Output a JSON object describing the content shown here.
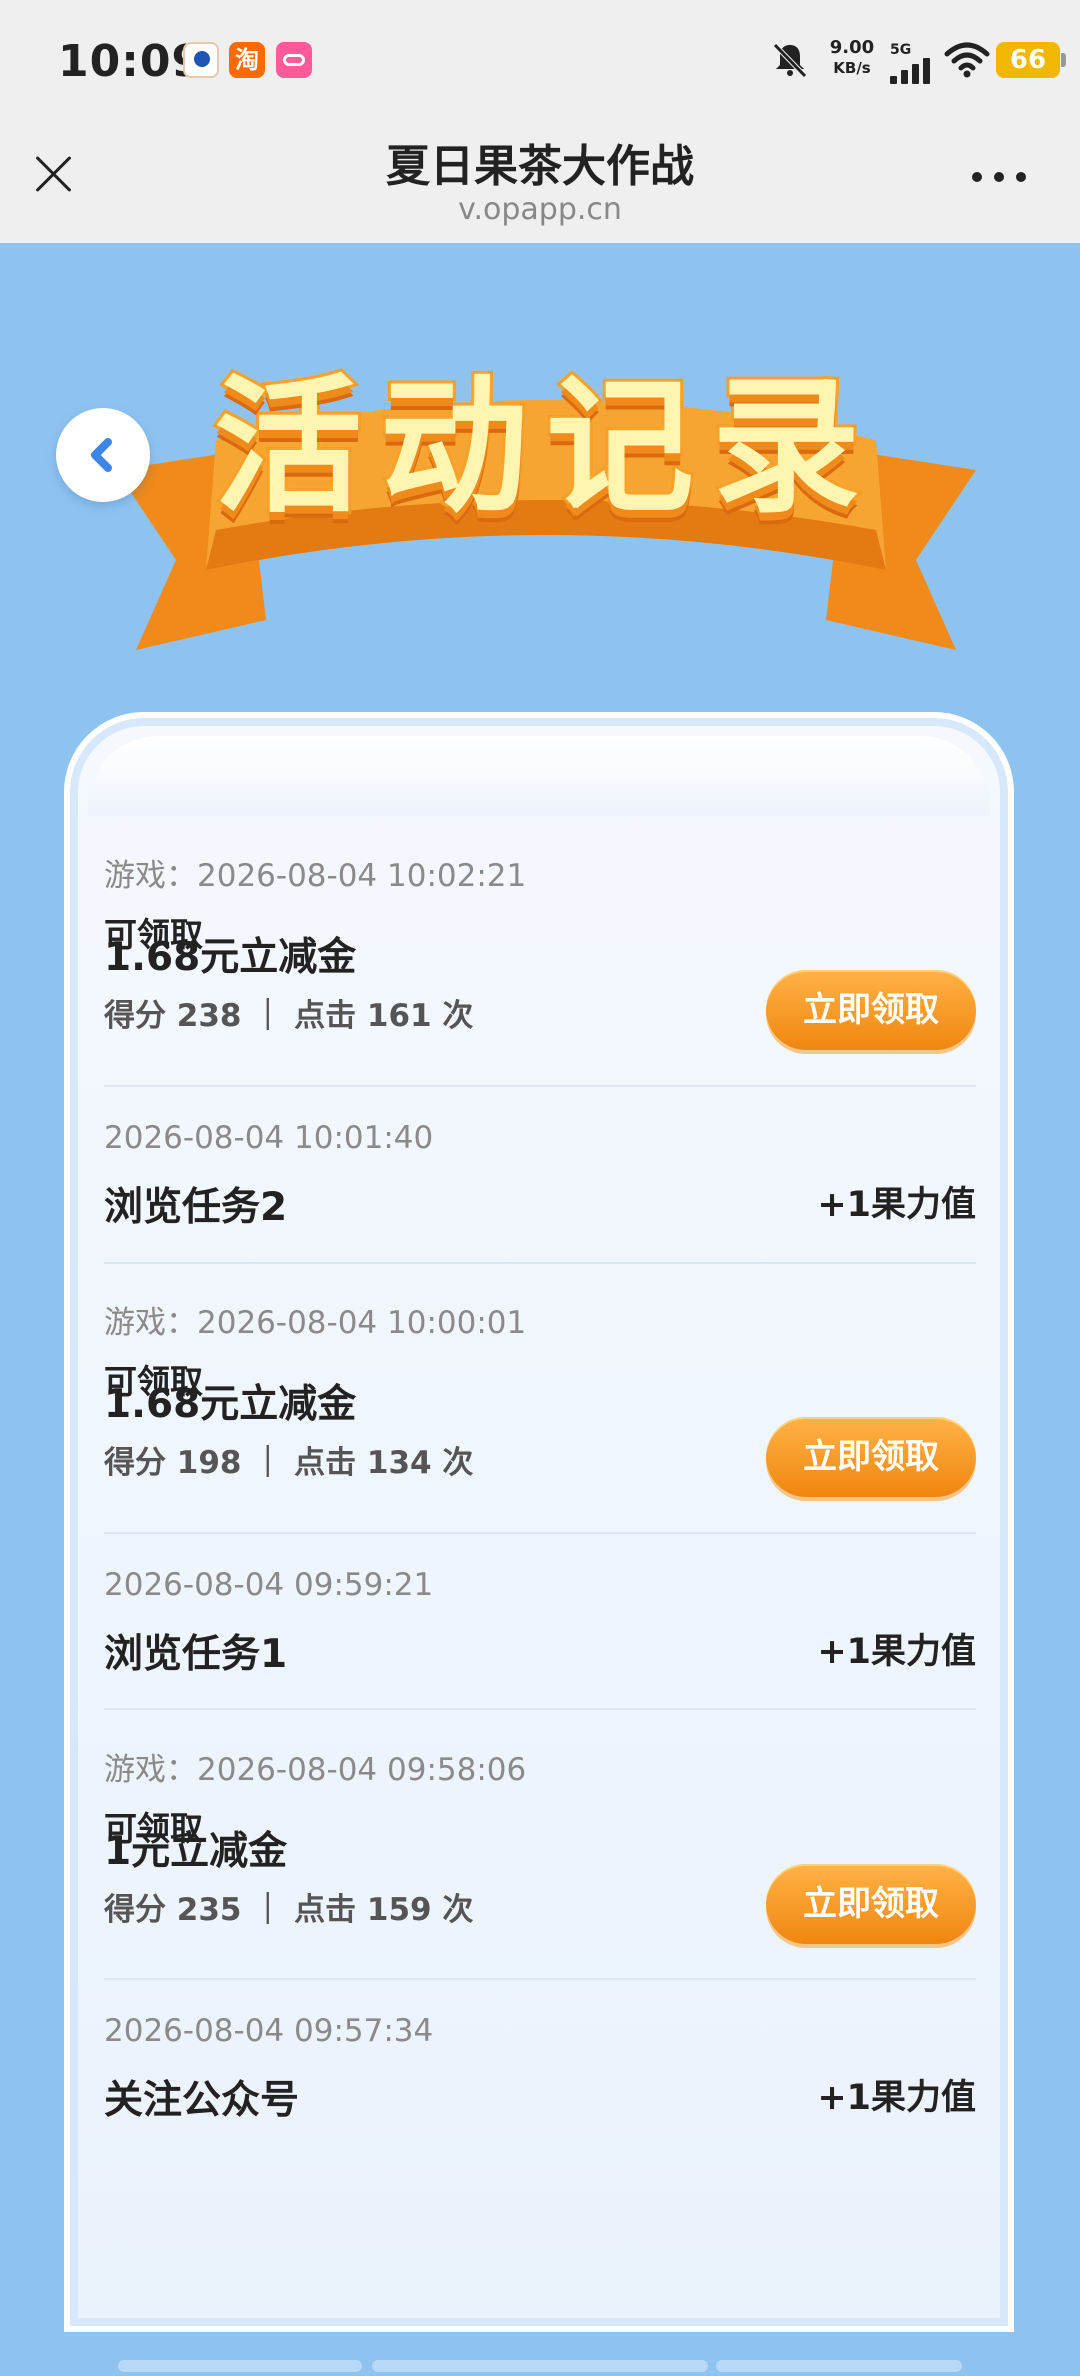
{
  "status_bar": {
    "time": "10:09",
    "speed_value": "9.00",
    "speed_unit": "KB/s",
    "network": "5G",
    "battery": "66"
  },
  "header": {
    "title": "夏日果茶大作战",
    "url": "v.opapp.cn"
  },
  "banner": {
    "title": "活动记录"
  },
  "records": [
    {
      "time": "游戏：2026-08-04 10:02:21",
      "name": "1.68元立减金",
      "meta": "得分 238 ｜ 点击 161 次",
      "status": "可领取",
      "button": "立即领取"
    },
    {
      "time": "2026-08-04 10:01:40",
      "name": "浏览任务2",
      "reward": "+1果力值"
    },
    {
      "time": "游戏：2026-08-04 10:00:01",
      "name": "1.68元立减金",
      "meta": "得分 198 ｜ 点击 134 次",
      "status": "可领取",
      "button": "立即领取"
    },
    {
      "time": "2026-08-04 09:59:21",
      "name": "浏览任务1",
      "reward": "+1果力值"
    },
    {
      "time": "游戏：2026-08-04 09:58:06",
      "name": "1元立减金",
      "meta": "得分 235 ｜ 点击 159 次",
      "status": "可领取",
      "button": "立即领取"
    },
    {
      "time": "2026-08-04 09:57:34",
      "name": "关注公众号",
      "reward": "+1果力值"
    }
  ],
  "colors": {
    "page_bg": "#8fc3ef",
    "button_orange": "#f0860f",
    "banner_orange": "#f29a24"
  }
}
